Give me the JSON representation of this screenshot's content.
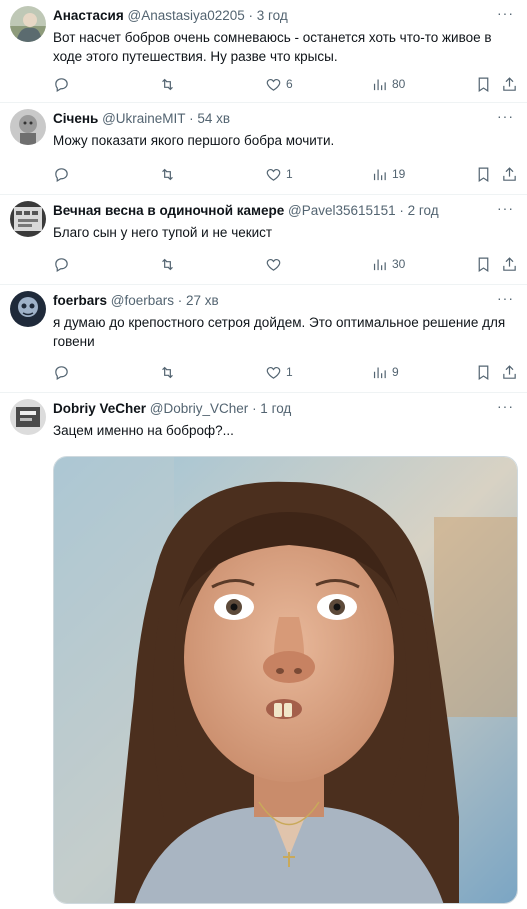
{
  "tweets": [
    {
      "name": "Анастасия",
      "handle": "@Anastasiya02205",
      "time": "· 3 год",
      "text": "Вот насчет бобров очень сомневаюсь - останется хоть что-то живое в ходе этого путешествия. Ну разве что крысы.",
      "reply_count": "",
      "retweet_count": "",
      "like_count": "6",
      "view_count": "80"
    },
    {
      "name": "Січень",
      "handle": "@UkraineMIT",
      "time": "· 54 хв",
      "text": "Можу показати якого першого бобра мочити.",
      "reply_count": "",
      "retweet_count": "",
      "like_count": "1",
      "view_count": "19"
    },
    {
      "name": "Вечная весна в одиночной камере",
      "handle": "@Pavel35615151",
      "time": "· 2 год",
      "text": "Благо сын у него тупой и не чекист",
      "reply_count": "",
      "retweet_count": "",
      "like_count": "",
      "view_count": "30"
    },
    {
      "name": "foerbars",
      "handle": "@foerbars",
      "time": "· 27 хв",
      "text": "я думаю до крепостного сетроя дойдем. Это оптимальное решение для говени",
      "reply_count": "",
      "retweet_count": "",
      "like_count": "1",
      "view_count": "9"
    },
    {
      "name": "Dobriy VeCher",
      "handle": "@Dobriy_VCher",
      "time": "· 1 год",
      "text": "Зацем именно на боброф?...",
      "has_photo": true
    }
  ],
  "icons": {
    "reply": "reply-icon",
    "retweet": "retweet-icon",
    "like": "heart-icon",
    "views": "views-icon",
    "bookmark": "bookmark-icon",
    "share": "share-icon",
    "more": "more-icon"
  },
  "colors": {
    "text": "#0f1419",
    "secondary": "#536471",
    "border": "#eff3f4"
  }
}
